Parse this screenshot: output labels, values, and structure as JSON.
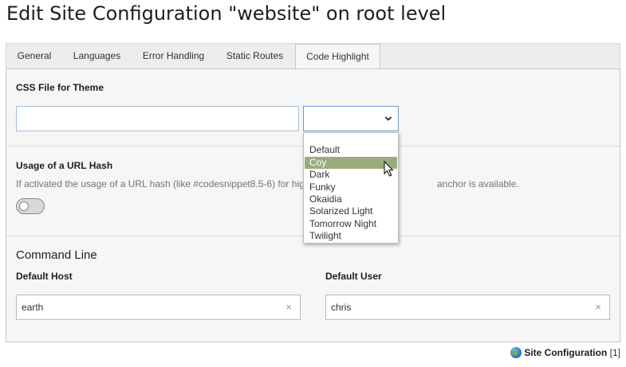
{
  "page": {
    "title": "Edit Site Configuration \"website\" on root level"
  },
  "tabs": [
    {
      "label": "General"
    },
    {
      "label": "Languages"
    },
    {
      "label": "Error Handling"
    },
    {
      "label": "Static Routes"
    },
    {
      "label": "Code Highlight",
      "active": true
    }
  ],
  "css_file": {
    "label": "CSS File for Theme",
    "value": "",
    "select_value": ""
  },
  "dropdown": {
    "options": [
      "",
      "Default",
      "Coy",
      "Dark",
      "Funky",
      "Okaidia",
      "Solarized Light",
      "Tomorrow Night",
      "Twilight"
    ],
    "highlighted": "Coy"
  },
  "url_hash": {
    "label": "Usage of a URL Hash",
    "description_left": "If activated the usage of a URL hash (like #codesnippet8.5-6) for hig",
    "description_right": "anchor is available.",
    "enabled": false
  },
  "command_line": {
    "heading": "Command Line",
    "host_label": "Default Host",
    "host_value": "earth",
    "user_label": "Default User",
    "user_value": "chris",
    "clear_glyph": "×"
  },
  "footer": {
    "label": "Site Configuration",
    "count": "[1]"
  },
  "icons": {
    "chevron": "chevron-down-icon",
    "toggle": "toggle-off-icon",
    "globe": "globe-icon",
    "cursor": "mouse-pointer-icon",
    "clear": "clear-icon"
  },
  "colors": {
    "highlight": "#99ac7e",
    "focus_border": "#6b9bc9",
    "panel_bg": "#f6f6f6"
  }
}
